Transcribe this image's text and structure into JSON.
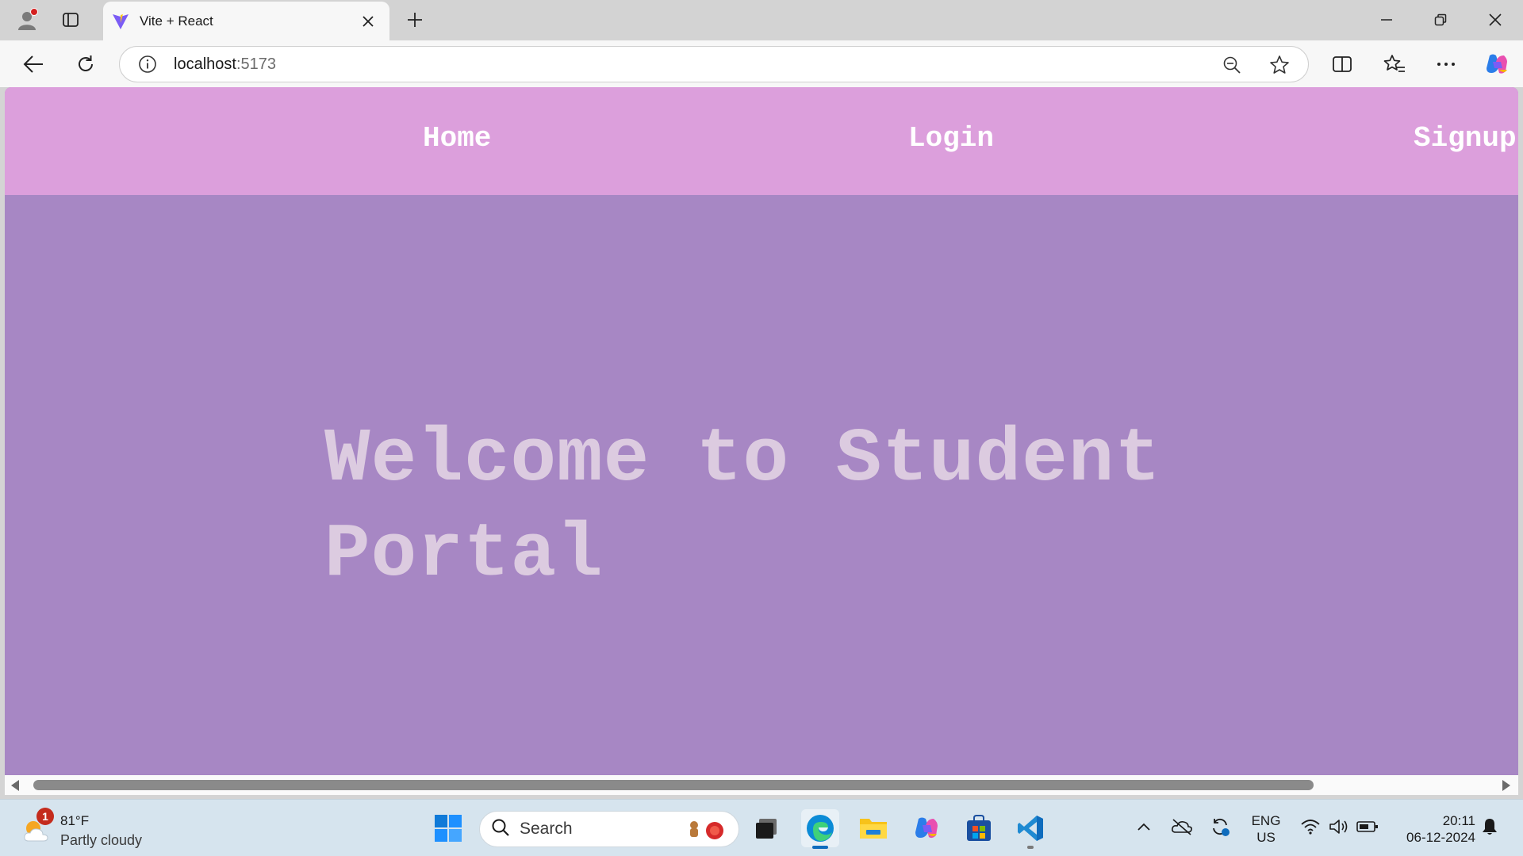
{
  "browser": {
    "tab": {
      "title": "Vite + React",
      "favicon": "vite-logo-icon"
    },
    "address": {
      "host": "localhost",
      "port": ":5173"
    },
    "icons": [
      "profile-icon",
      "tab-actions-icon",
      "close-icon",
      "plus-icon",
      "minimize-icon",
      "restore-icon",
      "back-arrow-icon",
      "reload-icon",
      "info-icon",
      "zoom-out-icon",
      "add-favorite-icon",
      "split-screen-icon",
      "favorites-icon",
      "more-icon",
      "copilot-icon"
    ]
  },
  "page": {
    "nav": {
      "home": "Home",
      "login": "Login",
      "signup": "Signup"
    },
    "hero": {
      "line1": "Welcome to Student",
      "line2": "Portal"
    },
    "colors": {
      "navbar": "#dc9fdc",
      "background": "#a787c4",
      "hero_text": "#dccbe0",
      "nav_text": "#ffffff"
    }
  },
  "taskbar": {
    "weather": {
      "temp": "81°F",
      "desc": "Partly cloudy",
      "badge": "1"
    },
    "search": {
      "label": "Search"
    },
    "apps": [
      "windows-start-icon",
      "task-view-icon",
      "edge-icon",
      "file-explorer-icon",
      "copilot-app-icon",
      "store-icon",
      "vscode-icon"
    ],
    "tray": {
      "lang_line1": "ENG",
      "lang_line2": "US",
      "time": "20:11",
      "date": "06-12-2024"
    }
  }
}
